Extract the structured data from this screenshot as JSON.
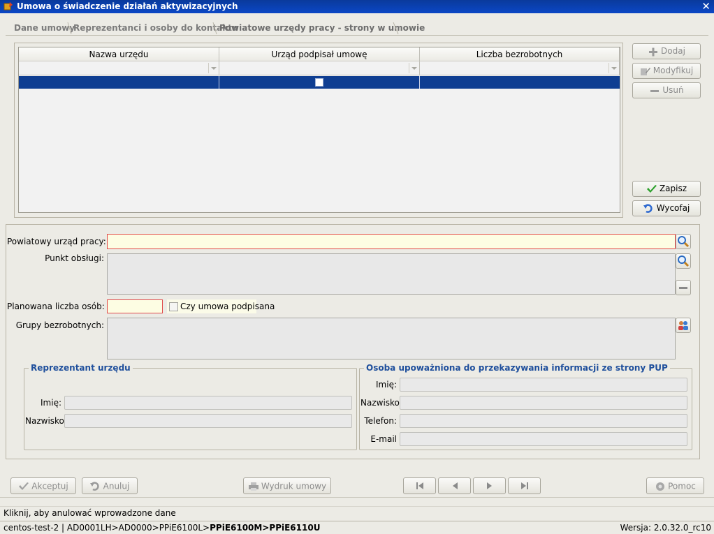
{
  "window": {
    "title": "Umowa o świadczenie działań aktywizacyjnych",
    "close_label": "✕"
  },
  "tabs": [
    {
      "label": "Dane umowy",
      "active": false
    },
    {
      "label": "Reprezentanci i osoby do kontaktu",
      "active": false
    },
    {
      "label": "Powiatowe urzędy pracy - strony w umowie",
      "active": true
    }
  ],
  "grid": {
    "columns": [
      "Nazwa urzędu",
      "Urząd podpisał umowę",
      "Liczba bezrobotnych"
    ],
    "rows": [
      {
        "name": "",
        "signed": false,
        "count": ""
      }
    ]
  },
  "side_buttons": {
    "add": "Dodaj",
    "modify": "Modyfikuj",
    "delete": "Usuń",
    "save": "Zapisz",
    "revert": "Wycofaj"
  },
  "form": {
    "pup_label": "Powiatowy urząd pracy:",
    "pup_value": "",
    "service_point_label": "Punkt obsługi:",
    "service_point_value": "",
    "planned_label": "Planowana liczba osób:",
    "planned_value": "",
    "signed_label": "Czy umowa podpisana",
    "groups_label": "Grupy bezrobotnych:",
    "groups_value": ""
  },
  "representative": {
    "title": "Reprezentant urzędu",
    "first_name_label": "Imię:",
    "first_name_value": "",
    "last_name_label": "Nazwisko:",
    "last_name_value": ""
  },
  "contact_person": {
    "title": "Osoba upoważniona do przekazywania informacji ze strony PUP",
    "first_name_label": "Imię:",
    "last_name_label": "Nazwisko:",
    "phone_label": "Telefon:",
    "email_label": "E-mail",
    "first_name_value": "",
    "last_name_value": "",
    "phone_value": "",
    "email_value": ""
  },
  "bottom_buttons": {
    "accept": "Akceptuj",
    "cancel": "Anuluj",
    "print": "Wydruk umowy",
    "help": "Pomoc"
  },
  "status": {
    "hint": "Kliknij, aby anulować wprowadzone dane",
    "path_normal": "centos-test-2 | AD0001LH>AD0000>PPiE6100L>",
    "path_bold": "PPiE6100M>PPiE6110U",
    "version": "Wersja: 2.0.32.0_rc10"
  },
  "colors": {
    "title_bar": "#0b47c6",
    "selected_row": "#0f3e92",
    "group_title": "#1f4f9c",
    "required_border": "#e04848",
    "required_bg": "#fdfde3"
  }
}
